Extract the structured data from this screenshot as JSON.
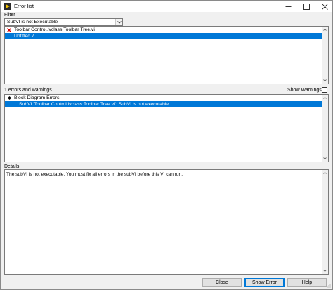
{
  "window": {
    "title": "Error list"
  },
  "filter": {
    "label": "Filter",
    "selected": "SubVI is not Executable"
  },
  "tree": {
    "items": [
      {
        "label": "Toolbar Control.lvclass:Toolbar Tree.vi"
      },
      {
        "label": "Untitled 7"
      }
    ]
  },
  "errors": {
    "summary": "1 errors and warnings",
    "show_warnings_label": "Show Warnings",
    "show_warnings_checked": false,
    "items": [
      {
        "label": "Block Diagram Errors"
      },
      {
        "label": "SubVI 'Toolbar Control.lvclass:Toolbar Tree.vi': SubVI is not executable"
      }
    ]
  },
  "details": {
    "label": "Details",
    "text": "The subVI is not executable. You must fix all errors in the subVI before this VI can run."
  },
  "buttons": {
    "close": "Close",
    "show_error": "Show Error",
    "help": "Help"
  },
  "colors": {
    "selection": "#0078d7",
    "error_icon": "#d40000"
  }
}
